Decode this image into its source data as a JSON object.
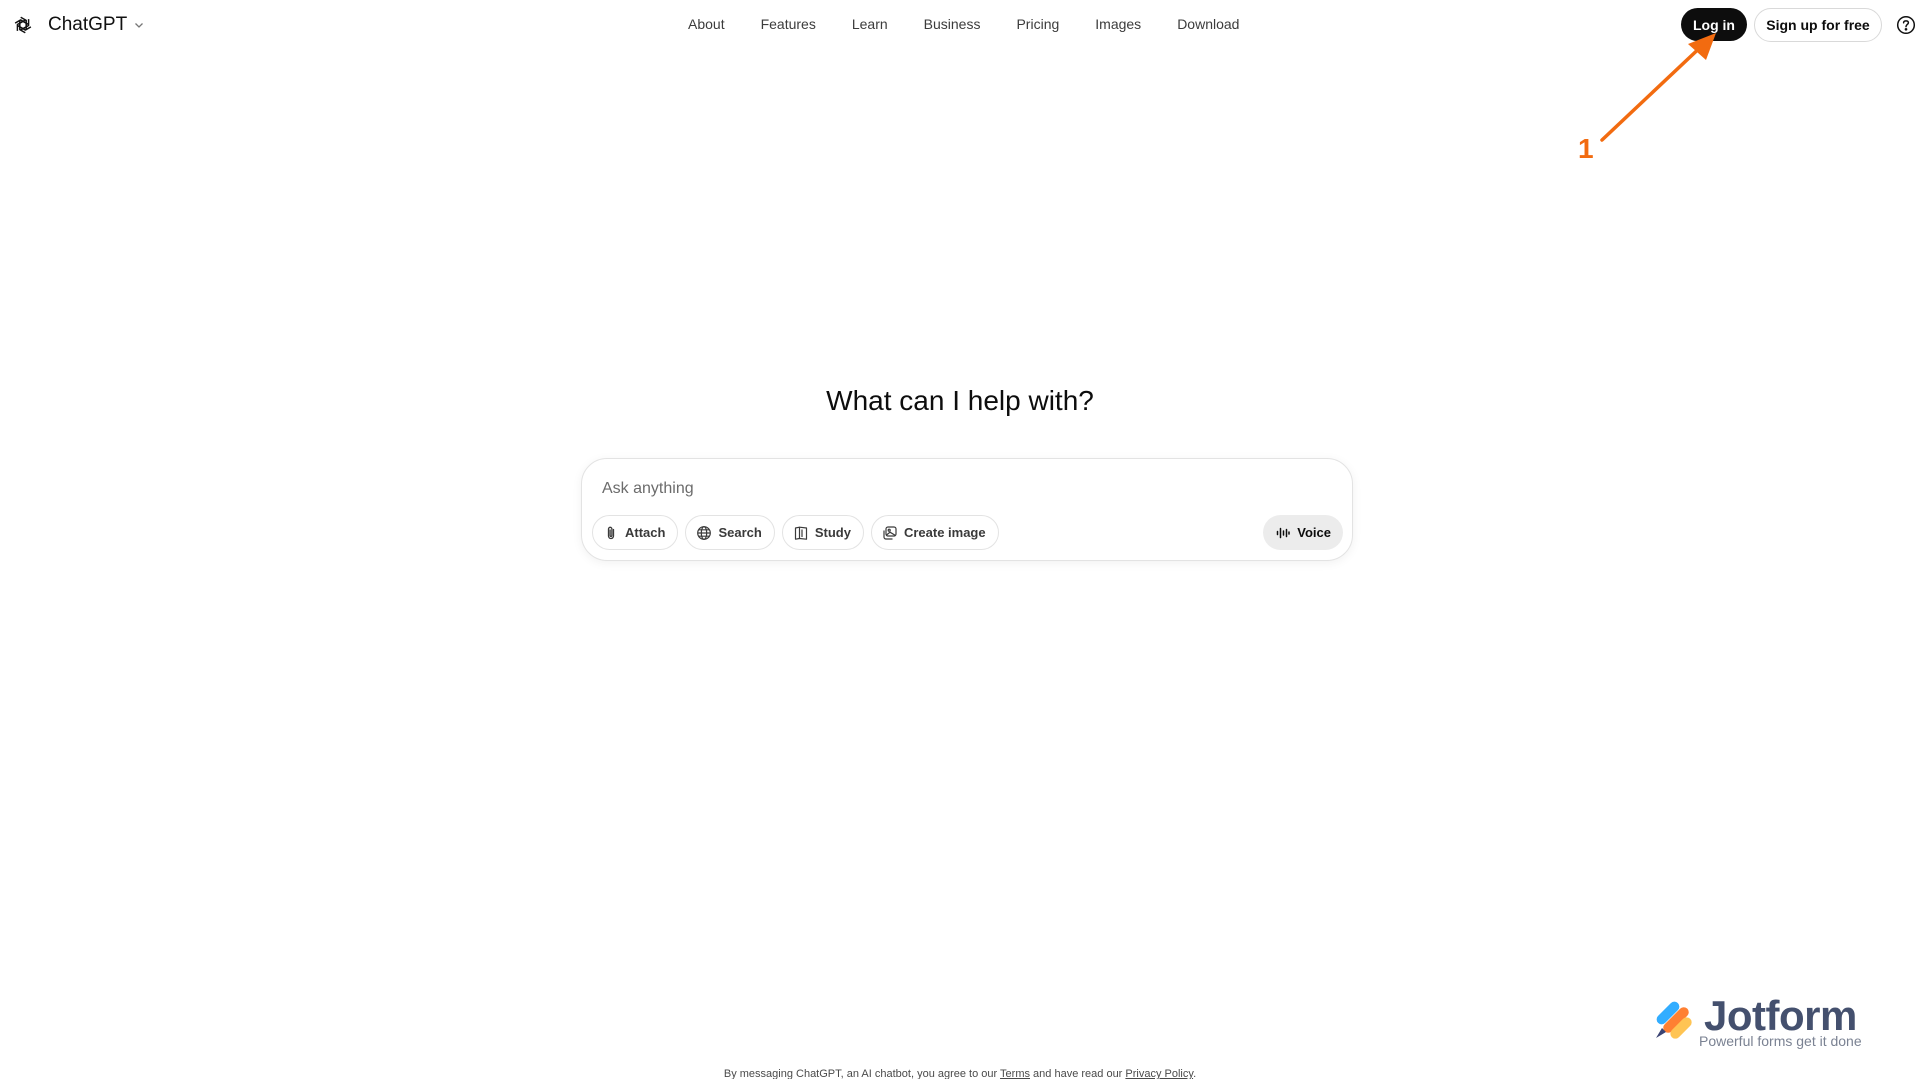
{
  "header": {
    "brand": "ChatGPT",
    "nav": [
      "About",
      "Features",
      "Learn",
      "Business",
      "Pricing",
      "Images",
      "Download"
    ],
    "login_label": "Log in",
    "signup_label": "Sign up for free"
  },
  "annotation": {
    "label": "1",
    "color": "#f26b10"
  },
  "main": {
    "title": "What can I help with?",
    "input_placeholder": "Ask anything",
    "tools": [
      {
        "label": "Attach",
        "icon": "paperclip-icon"
      },
      {
        "label": "Search",
        "icon": "globe-icon"
      },
      {
        "label": "Study",
        "icon": "book-icon"
      },
      {
        "label": "Create image",
        "icon": "image-icon"
      }
    ],
    "voice_label": "Voice"
  },
  "footer": {
    "prefix": "By messaging ChatGPT, an AI chatbot, you agree to our ",
    "terms": "Terms",
    "middle": " and have read our ",
    "privacy": "Privacy Policy",
    "suffix": "."
  },
  "watermark": {
    "name": "Jotform",
    "tagline": "Powerful forms get it done"
  }
}
